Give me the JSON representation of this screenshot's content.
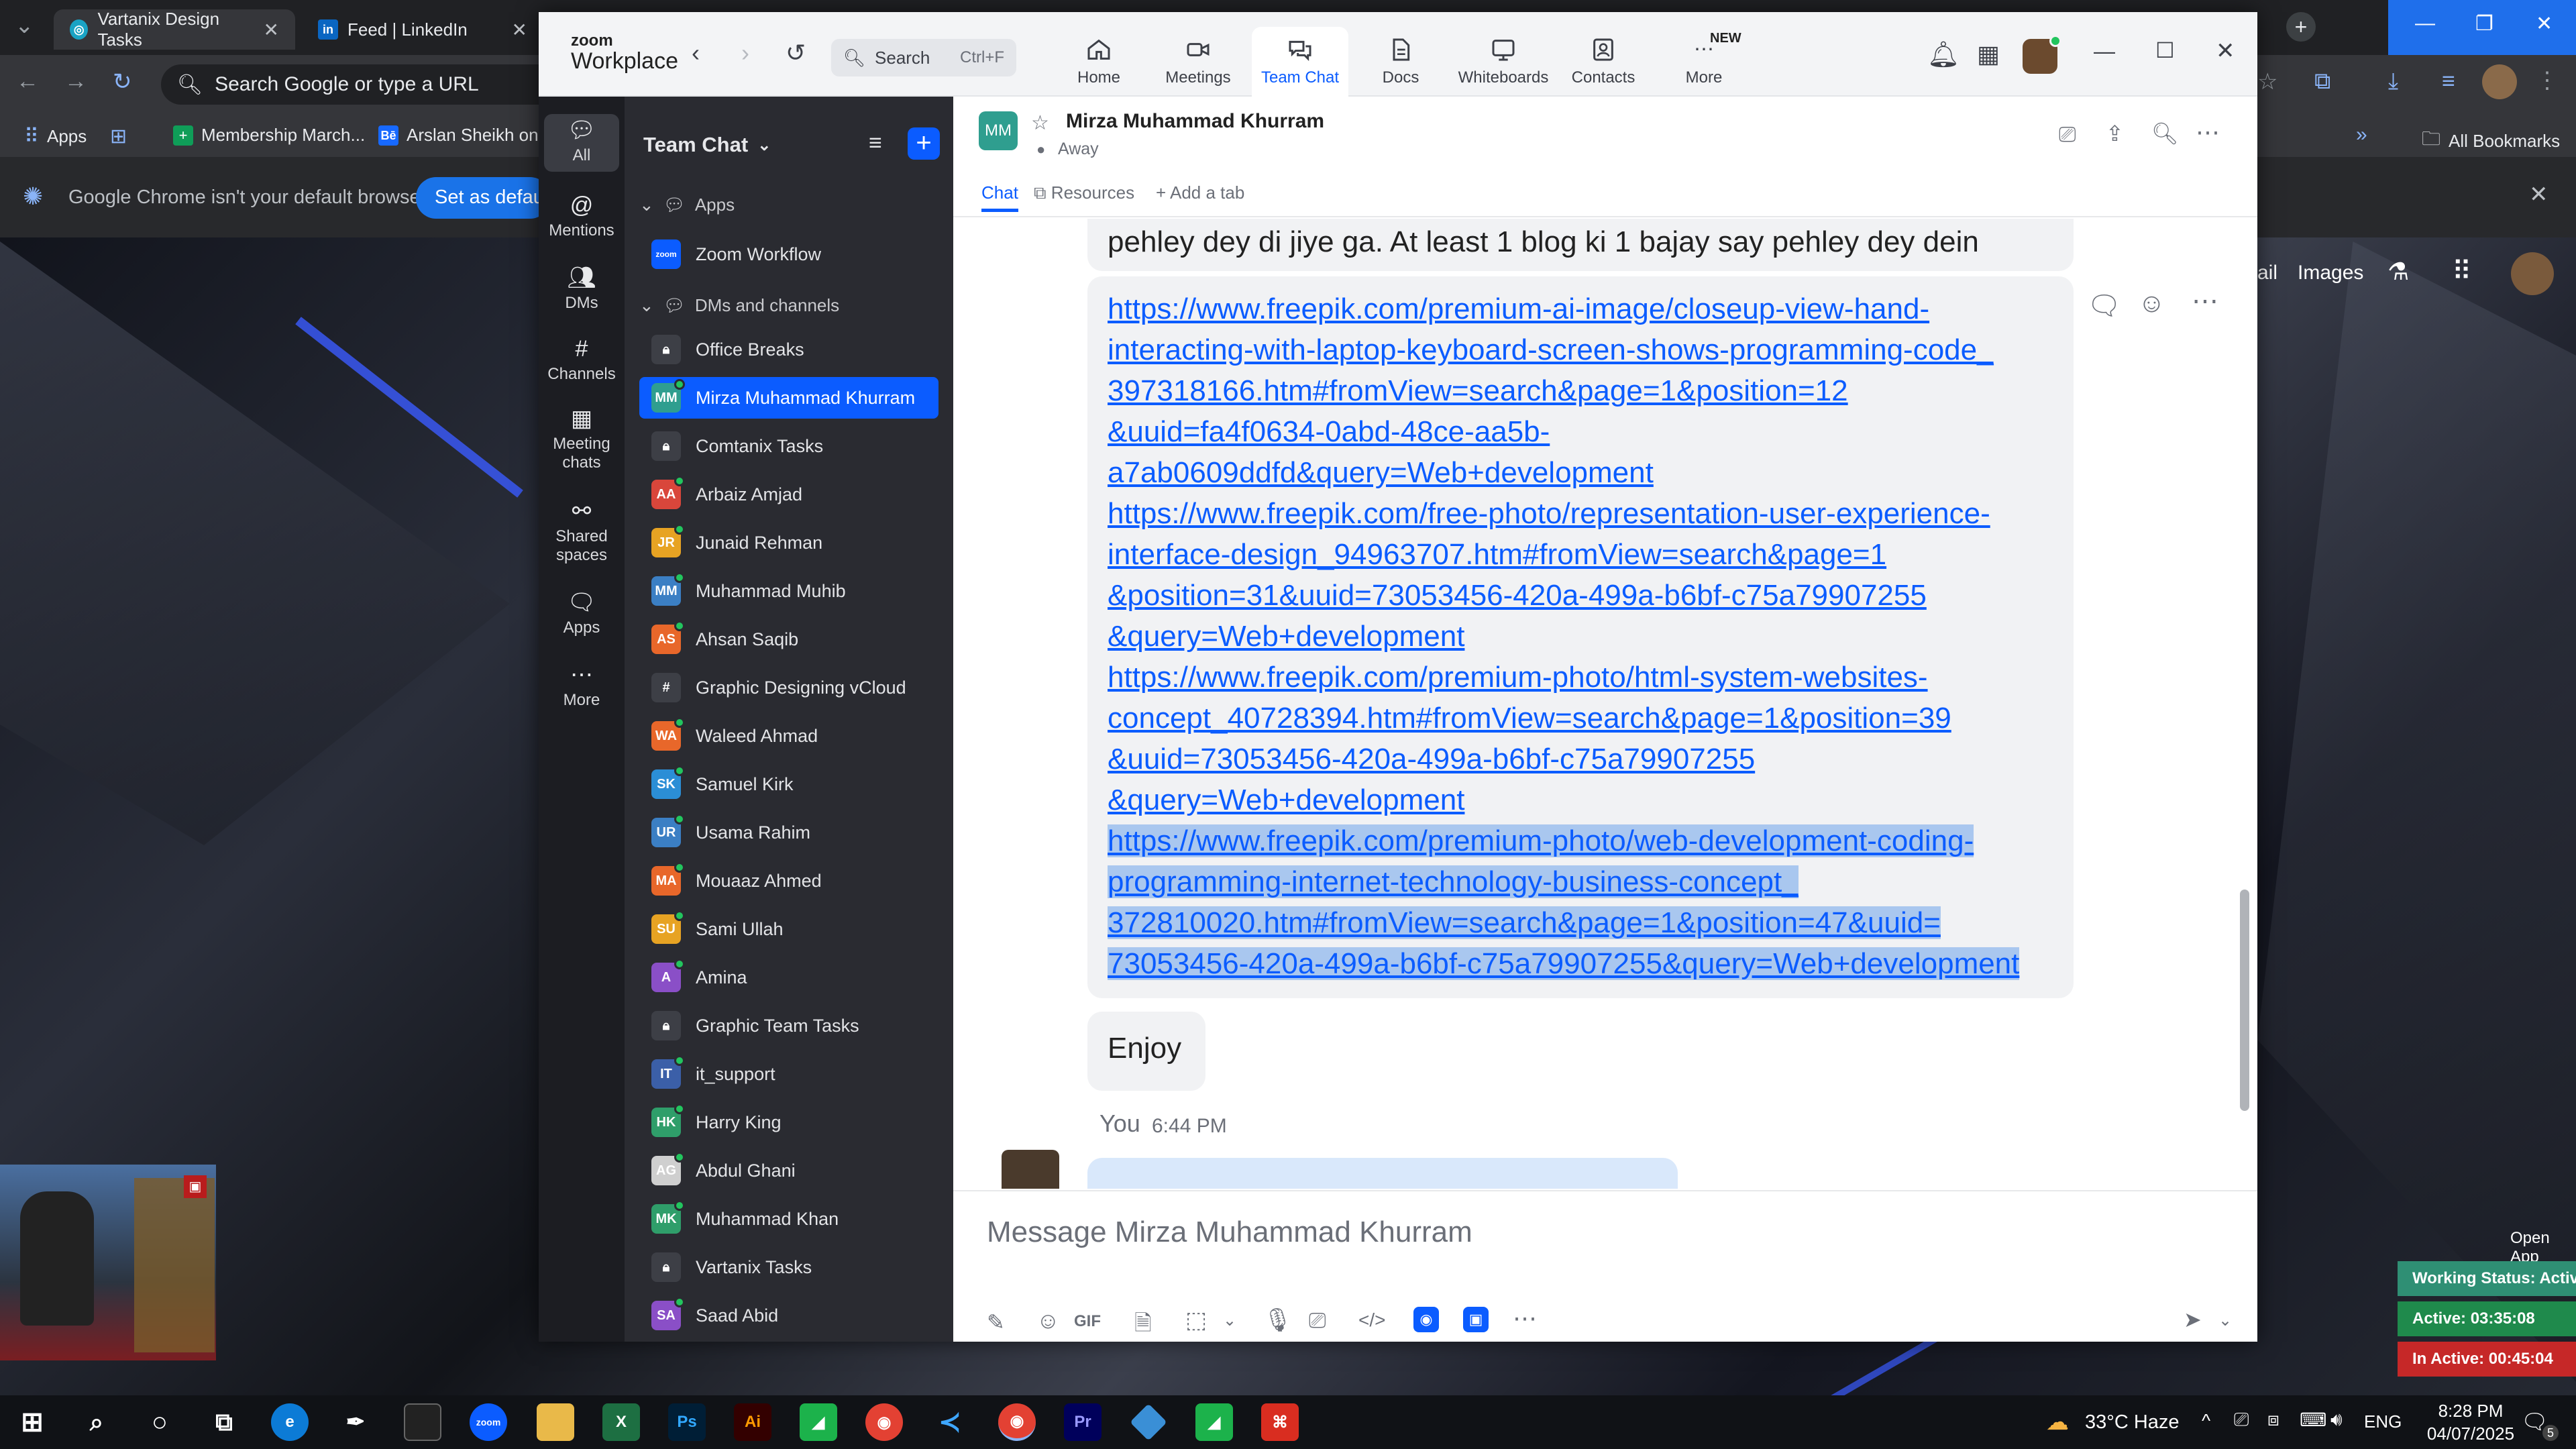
{
  "browser": {
    "tabs": [
      {
        "label": "Vartanix Design Tasks"
      },
      {
        "label": "Feed | LinkedIn"
      }
    ],
    "omnibox_placeholder": "Search Google or type a URL",
    "bookmarks": [
      {
        "label": "Apps"
      },
      {
        "label": "Membership March..."
      },
      {
        "label": "Arslan Sheikh on B"
      }
    ],
    "all_bookmarks": "All Bookmarks",
    "infobar_text": "Google Chrome isn't your default browser",
    "infobar_button": "Set as default",
    "google_links": [
      "ail",
      "Images"
    ],
    "open_app": "Open App"
  },
  "zoom": {
    "brand_top": "zoom",
    "brand_bottom": "Workplace",
    "search_label": "Search",
    "search_shortcut": "Ctrl+F",
    "tabs": [
      {
        "label": "Home"
      },
      {
        "label": "Meetings"
      },
      {
        "label": "Team Chat"
      },
      {
        "label": "Docs"
      },
      {
        "label": "Whiteboards"
      },
      {
        "label": "Contacts"
      },
      {
        "label": "More",
        "badge": "NEW"
      }
    ],
    "rail": [
      {
        "label": "All"
      },
      {
        "label": "Mentions"
      },
      {
        "label": "DMs"
      },
      {
        "label": "Channels"
      },
      {
        "label": "Meeting chats"
      },
      {
        "label": "Shared spaces"
      },
      {
        "label": "Apps"
      },
      {
        "label": "More"
      }
    ],
    "sidebar_title": "Team Chat",
    "section_apps": "Apps",
    "app_items": [
      {
        "label": "Zoom Workflow",
        "initials": "zoom"
      }
    ],
    "section_dms": "DMs and channels",
    "dm_items": [
      {
        "label": "Office Breaks",
        "initials": "",
        "color": "#3d3f46"
      },
      {
        "label": "Mirza Muhammad Khurram",
        "initials": "MM",
        "color": "#2f9e8f"
      },
      {
        "label": "Comtanix Tasks",
        "initials": "",
        "color": "#3d3f46"
      },
      {
        "label": "Arbaiz Amjad",
        "initials": "AA",
        "color": "#d9463b"
      },
      {
        "label": "Junaid Rehman",
        "initials": "JR",
        "color": "#e7a323"
      },
      {
        "label": "Muhammad Muhib",
        "initials": "MM",
        "color": "#3b7fc4"
      },
      {
        "label": "Ahsan Saqib",
        "initials": "AS",
        "color": "#e8672a"
      },
      {
        "label": "Graphic Designing vCloud",
        "initials": "#",
        "color": "#3d3f46"
      },
      {
        "label": "Waleed Ahmad",
        "initials": "WA",
        "color": "#e8672a"
      },
      {
        "label": "Samuel Kirk",
        "initials": "SK",
        "color": "#2b8ed6"
      },
      {
        "label": "Usama Rahim",
        "initials": "UR",
        "color": "#3b7fc4"
      },
      {
        "label": "Mouaaz Ahmed",
        "initials": "MA",
        "color": "#e8672a"
      },
      {
        "label": "Sami Ullah",
        "initials": "SU",
        "color": "#e7a323"
      },
      {
        "label": "Amina",
        "initials": "A",
        "color": "#8a4fc7"
      },
      {
        "label": "Graphic Team Tasks",
        "initials": "",
        "color": "#3d3f46"
      },
      {
        "label": "it_support",
        "initials": "IT",
        "color": "#3b5fa8"
      },
      {
        "label": "Harry King",
        "initials": "HK",
        "color": "#2f9e6a"
      },
      {
        "label": "Abdul Ghani",
        "initials": "AG",
        "color": "#cfcfcf"
      },
      {
        "label": "Muhammad Khan",
        "initials": "MK",
        "color": "#2f9e6a"
      },
      {
        "label": "Vartanix Tasks",
        "initials": "",
        "color": "#3d3f46"
      },
      {
        "label": "Saad Abid",
        "initials": "SA",
        "color": "#8a4fc7"
      }
    ],
    "chat": {
      "avatar": "MM",
      "name": "Mirza Muhammad Khurram",
      "presence": "Away",
      "tabs": [
        {
          "label": "Chat"
        },
        {
          "label": "Resources"
        },
        {
          "label": "Add a tab"
        }
      ],
      "message_top": "pehley dey di jiye ga. At least 1 blog ki 1 bajay say pehley dey dein",
      "links": [
        [
          "https://www.freepik.com/premium-ai-image/closeup-view-hand-",
          "interacting-with-laptop-keyboard-screen-shows-programming-code_",
          "397318166.htm#fromView=search&page=1&position=12",
          "&uuid=fa4f0634-0abd-48ce-aa5b-",
          "a7ab0609ddfd&query=Web+development"
        ],
        [
          "https://www.freepik.com/free-photo/representation-user-experience-",
          "interface-design_94963707.htm#fromView=search&page=1",
          "&position=31&uuid=73053456-420a-499a-b6bf-c75a79907255",
          "&query=Web+development"
        ],
        [
          "https://www.freepik.com/premium-photo/html-system-websites-",
          "concept_40728394.htm#fromView=search&page=1&position=39",
          "&uuid=73053456-420a-499a-b6bf-c75a79907255",
          "&query=Web+development"
        ],
        [
          "https://www.freepik.com/premium-photo/web-development-coding-",
          "programming-internet-technology-business-concept_",
          "372810020.htm#fromView=search&page=1&position=47&uuid=",
          "73053456-420a-499a-b6bf-c75a79907255&query=Web+development"
        ]
      ],
      "enjoy": "Enjoy",
      "you_label": "You",
      "you_time": "6:44 PM",
      "composer_placeholder": "Message Mirza Muhammad Khurram",
      "gif_label": "GIF"
    }
  },
  "tracker": {
    "working_status": "Working Status: Active",
    "active": "Active: 03:35:08",
    "inactive": "In Active: 00:45:04"
  },
  "taskbar": {
    "weather": "33°C Haze",
    "lang": "ENG",
    "time": "8:28 PM",
    "date": "04/07/2025",
    "notif_count": "5",
    "zoom_icon": "zoom",
    "excel_icon": "X",
    "ps_icon": "Ps",
    "ai_icon": "Ai",
    "pr_icon": "Pr"
  }
}
